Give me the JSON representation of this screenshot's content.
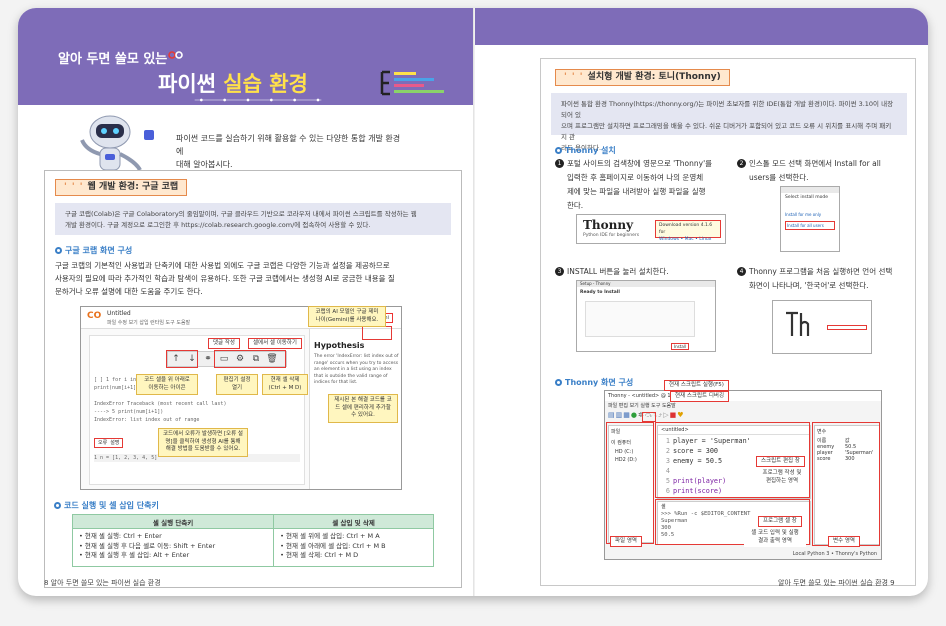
{
  "left_page": {
    "banner_subtitle": "알아 두면 쓸모 있는",
    "banner_title_prefix": "파이썬 ",
    "banner_title_highlight": "실습 환경",
    "intro_line1": "파이썬 코드를 실습하기 위해 활용할 수 있는 다양한 통합 개발 환경에",
    "intro_line2": "대해 알아봅시다.",
    "section_tag": "웹 개발 환경: 구글 코랩",
    "info_line1": "구글 코랩(Colab)은 구글 Colaboratory의 줄임말이며, 구글 클라우드 기반으로 코라우저 내에서 파이썬 스크립트를 작성하는 웹",
    "info_line2": "개발 환경이다. 구글 계정으로 로그인한 후 https://colab.research.google.com/에 접속하여 사용할 수 있다.",
    "sub1": "구글 코랩 화면 구성",
    "para1_l1": "구글 코랩의 기본적인 사용법과 단축키에 대한 사용법 외에도 구글 코랩은 다양한 기능과 설정을 제공하므로",
    "para1_l2": "사용자의 필요에 따라 추가적인 학습과 탐색이 유용하다. 또한 구글 코랩에서는 생성형 AI로 궁금한 내용을 질",
    "para1_l3": "문하거나 오류 설명에 대한 도움을 주기도 한다.",
    "colab": {
      "file_title": "Untitled",
      "menu": "파일  수정  보기  삽입  런타임  도구  도움말",
      "gemini_btn": "Gemini",
      "hyp_title": "Hypothesis",
      "hyp_text": "The error 'IndexError: list index out of range' occurs when you try to access an element in a list using an index that is outside the valid range of indices for that list.",
      "code_l1": "[ ]  1  for i in range(len(num)):",
      "code_l2": "          print(num[i+1])",
      "code_l3": "IndexError    Traceback (most recent call last)",
      "code_l4": "----> 5 print(num[i+1])",
      "code_l5": "IndexError: list index out of range",
      "code_l6": "오류 설명",
      "code_l7": "1  n = [1, 2, 3, 4, 5]",
      "callout_gemini": "코랩의 AI 모델인 구글 제미나이(Gemini)를 사용해요.",
      "pill_comment": "댓글 작성",
      "pill_delete": "셀에서 셀 이동하기",
      "callout_move": "코드 셀을 위 아래로 이동하는 아이콘",
      "callout_edit": "편집기 설정 열기",
      "callout_delete": "현재 셀 삭제 (Ctrl + M D)",
      "callout_fix": "제시된 본 해결 코드를 코드 셀에 편리하게 추가할 수 있어요.",
      "callout_error": "코드에서 오류가 발생하면 [오류 설명]을 클릭하여 생성형 AI를 통해 해결 방법을 도움받을 수 있어요."
    },
    "sub2": "코드 실행 및 셀 삽입 단축키",
    "table_headers": [
      "셀 실행 단축키",
      "셀 삽입 및 삭제"
    ],
    "table_col1": [
      "• 현재 셀 실행: Ctrl + Enter",
      "• 현재 셀 실행 후 다음 셀로 이동: Shift + Enter",
      "• 현재 셀 실행 후 셀 삽입: Alt + Enter"
    ],
    "table_col2": [
      "• 현재 셀 위에 셀 삽입: Ctrl + M A",
      "• 현재 셀 아래에 셀 삽입: Ctrl + M B",
      "• 현재 셀 삭제: Ctrl + M D"
    ],
    "footer": "8  알아 두면 쓸모 있는 파이썬 실습 환경"
  },
  "right_page": {
    "section_tag": "설치형 개발 환경: 토니(Thonny)",
    "info_line1": "파이썬 통합 환경 Thonny(https://thonny.org/)는 파이썬 초보자를 위한 IDE(통합 개발 환경)이다. 파이썬 3.10이 내장되어 있",
    "info_line2": "으며 프로그램만 설치하면 프로그래밍을 배울 수 있다. 쉬운 디버거가 포함되어 있고 코드 오류 시 위치를 표시해 주며 패키지 관",
    "info_line3": "리도 용이하다.",
    "sub1": "Thonny 설치",
    "step1_l1": "포털 사이트의 검색창에 영문으로 'Thonny'를",
    "step1_l2": "입력한 후 홈페이지로 이동하여 나의 운영체",
    "step1_l3": "제에 맞는 파일을 내려받아 실행 파일을 실행",
    "step1_l4": "한다.",
    "step2_l1": "인스톨 모드 선택 화면에서 Install for all",
    "step2_l2": "users를 선택한다.",
    "step3_l1": "INSTALL 버튼을 눌러 설치한다.",
    "step4_l1": "Thonny 프로그램을 처음 실행하면 언어 선택",
    "step4_l2": "화면이 나타나며, '한국어'로 선택한다.",
    "thonny_logo": "Thonny",
    "thonny_logo_sub": "Python IDE for beginners",
    "download_title": "Download version 4.1.6 for",
    "download_os": "Windows • Mac • Linux",
    "install_mode_title": "Select install mode",
    "install_mode_opt1": "Install for me only",
    "install_mode_opt2": "Install for all users",
    "setup_title": "Setup - Thonny",
    "setup_ready": "Ready to Install",
    "setup_btn": "Install",
    "sub2": "Thonny 화면 구성",
    "thonny_title": "Thonny - <untitled> @ 1:1",
    "menu_items": "파일  편집  보기  실행  도구  도움말",
    "files_label": "파일",
    "files_tree": "이 컴퓨터",
    "files_c": "HD (C:)",
    "files_d": "HD2 (D:)",
    "editor_tab": "<untitled>",
    "code_lines": [
      "player = 'Superman'",
      "score = 300",
      "enemy = 50.5",
      "",
      "print(player)",
      "print(score)",
      "print(enemy)"
    ],
    "shell_label": "셸",
    "shell_cmd": ">>> %Run -c $EDITOR_CONTENT",
    "shell_out": [
      "Superman",
      "300",
      "50.5"
    ],
    "shell_prompt": ">>>",
    "vars_label": "변수",
    "vars_headers": [
      "이름",
      "값"
    ],
    "vars_rows": [
      [
        "enemy",
        "50.5"
      ],
      [
        "player",
        "'Superman'"
      ],
      [
        "score",
        "300"
      ]
    ],
    "status": "Local Python 3  •  Thonny's Python",
    "pill_run": "현재 스크립트 실행(F5)",
    "pill_debug": "현재 스크립트 디버깅",
    "pill_editor": "스크립트 편집 창",
    "pill_editor_desc": "프로그램 작성 및 편집하는 영역",
    "pill_shell": "프로그램 셸 창",
    "pill_shell_desc": "셸 코드 입력 및 실행 결과 출력 영역",
    "pill_files": "파일 영역",
    "pill_vars": "변수 영역",
    "footer": "알아 두면 쓸모 있는 파이썬 실습 환경  9"
  },
  "colors": {
    "banner": "#7e6cb8",
    "accent_yellow": "#ffe14a",
    "tag_orange": "#e58a4c",
    "heading_blue": "#3a7fc7",
    "highlight_red": "#e53935"
  }
}
